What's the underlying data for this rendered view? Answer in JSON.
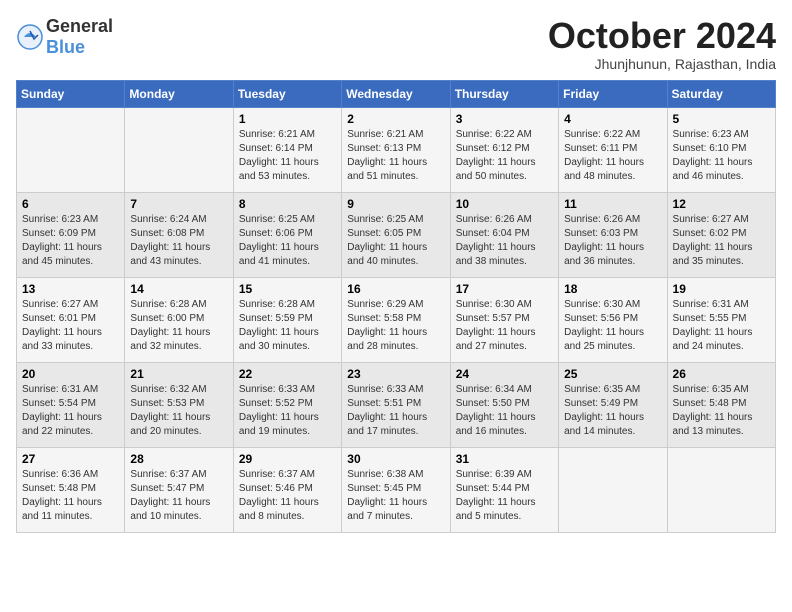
{
  "header": {
    "logo_general": "General",
    "logo_blue": "Blue",
    "month_title": "October 2024",
    "subtitle": "Jhunjhunun, Rajasthan, India"
  },
  "days_of_week": [
    "Sunday",
    "Monday",
    "Tuesday",
    "Wednesday",
    "Thursday",
    "Friday",
    "Saturday"
  ],
  "weeks": [
    [
      {
        "day": "",
        "info": ""
      },
      {
        "day": "",
        "info": ""
      },
      {
        "day": "1",
        "info": "Sunrise: 6:21 AM\nSunset: 6:14 PM\nDaylight: 11 hours and 53 minutes."
      },
      {
        "day": "2",
        "info": "Sunrise: 6:21 AM\nSunset: 6:13 PM\nDaylight: 11 hours and 51 minutes."
      },
      {
        "day": "3",
        "info": "Sunrise: 6:22 AM\nSunset: 6:12 PM\nDaylight: 11 hours and 50 minutes."
      },
      {
        "day": "4",
        "info": "Sunrise: 6:22 AM\nSunset: 6:11 PM\nDaylight: 11 hours and 48 minutes."
      },
      {
        "day": "5",
        "info": "Sunrise: 6:23 AM\nSunset: 6:10 PM\nDaylight: 11 hours and 46 minutes."
      }
    ],
    [
      {
        "day": "6",
        "info": "Sunrise: 6:23 AM\nSunset: 6:09 PM\nDaylight: 11 hours and 45 minutes."
      },
      {
        "day": "7",
        "info": "Sunrise: 6:24 AM\nSunset: 6:08 PM\nDaylight: 11 hours and 43 minutes."
      },
      {
        "day": "8",
        "info": "Sunrise: 6:25 AM\nSunset: 6:06 PM\nDaylight: 11 hours and 41 minutes."
      },
      {
        "day": "9",
        "info": "Sunrise: 6:25 AM\nSunset: 6:05 PM\nDaylight: 11 hours and 40 minutes."
      },
      {
        "day": "10",
        "info": "Sunrise: 6:26 AM\nSunset: 6:04 PM\nDaylight: 11 hours and 38 minutes."
      },
      {
        "day": "11",
        "info": "Sunrise: 6:26 AM\nSunset: 6:03 PM\nDaylight: 11 hours and 36 minutes."
      },
      {
        "day": "12",
        "info": "Sunrise: 6:27 AM\nSunset: 6:02 PM\nDaylight: 11 hours and 35 minutes."
      }
    ],
    [
      {
        "day": "13",
        "info": "Sunrise: 6:27 AM\nSunset: 6:01 PM\nDaylight: 11 hours and 33 minutes."
      },
      {
        "day": "14",
        "info": "Sunrise: 6:28 AM\nSunset: 6:00 PM\nDaylight: 11 hours and 32 minutes."
      },
      {
        "day": "15",
        "info": "Sunrise: 6:28 AM\nSunset: 5:59 PM\nDaylight: 11 hours and 30 minutes."
      },
      {
        "day": "16",
        "info": "Sunrise: 6:29 AM\nSunset: 5:58 PM\nDaylight: 11 hours and 28 minutes."
      },
      {
        "day": "17",
        "info": "Sunrise: 6:30 AM\nSunset: 5:57 PM\nDaylight: 11 hours and 27 minutes."
      },
      {
        "day": "18",
        "info": "Sunrise: 6:30 AM\nSunset: 5:56 PM\nDaylight: 11 hours and 25 minutes."
      },
      {
        "day": "19",
        "info": "Sunrise: 6:31 AM\nSunset: 5:55 PM\nDaylight: 11 hours and 24 minutes."
      }
    ],
    [
      {
        "day": "20",
        "info": "Sunrise: 6:31 AM\nSunset: 5:54 PM\nDaylight: 11 hours and 22 minutes."
      },
      {
        "day": "21",
        "info": "Sunrise: 6:32 AM\nSunset: 5:53 PM\nDaylight: 11 hours and 20 minutes."
      },
      {
        "day": "22",
        "info": "Sunrise: 6:33 AM\nSunset: 5:52 PM\nDaylight: 11 hours and 19 minutes."
      },
      {
        "day": "23",
        "info": "Sunrise: 6:33 AM\nSunset: 5:51 PM\nDaylight: 11 hours and 17 minutes."
      },
      {
        "day": "24",
        "info": "Sunrise: 6:34 AM\nSunset: 5:50 PM\nDaylight: 11 hours and 16 minutes."
      },
      {
        "day": "25",
        "info": "Sunrise: 6:35 AM\nSunset: 5:49 PM\nDaylight: 11 hours and 14 minutes."
      },
      {
        "day": "26",
        "info": "Sunrise: 6:35 AM\nSunset: 5:48 PM\nDaylight: 11 hours and 13 minutes."
      }
    ],
    [
      {
        "day": "27",
        "info": "Sunrise: 6:36 AM\nSunset: 5:48 PM\nDaylight: 11 hours and 11 minutes."
      },
      {
        "day": "28",
        "info": "Sunrise: 6:37 AM\nSunset: 5:47 PM\nDaylight: 11 hours and 10 minutes."
      },
      {
        "day": "29",
        "info": "Sunrise: 6:37 AM\nSunset: 5:46 PM\nDaylight: 11 hours and 8 minutes."
      },
      {
        "day": "30",
        "info": "Sunrise: 6:38 AM\nSunset: 5:45 PM\nDaylight: 11 hours and 7 minutes."
      },
      {
        "day": "31",
        "info": "Sunrise: 6:39 AM\nSunset: 5:44 PM\nDaylight: 11 hours and 5 minutes."
      },
      {
        "day": "",
        "info": ""
      },
      {
        "day": "",
        "info": ""
      }
    ]
  ]
}
